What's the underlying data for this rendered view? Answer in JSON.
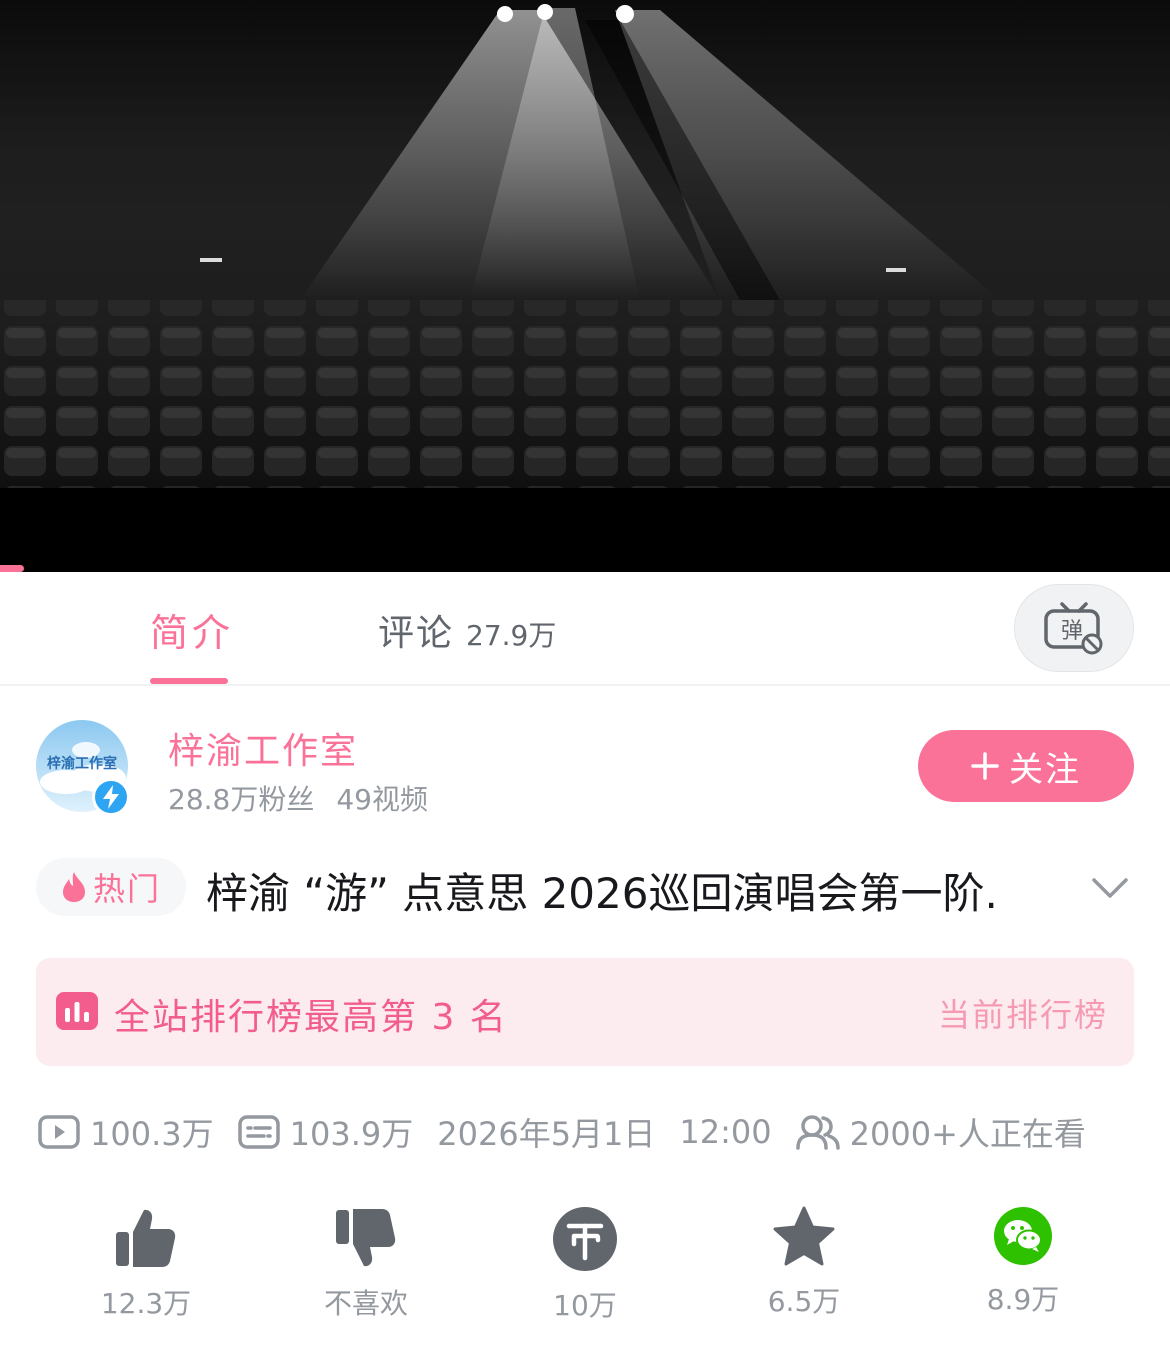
{
  "tabs": {
    "intro_label": "简介",
    "comment_label": "评论",
    "comment_count": "27.9万",
    "danmaku_icon": "danmaku-off-icon"
  },
  "uploader": {
    "name": "梓渝工作室",
    "avatar_text": "梓渝工作室",
    "fans": "28.8万粉丝",
    "videos": "49视频",
    "follow_label": "关注"
  },
  "video": {
    "hot_label": "热门",
    "title": "梓渝 “游” 点意思 2026巡回演唱会第一阶."
  },
  "ranking": {
    "text": "全站排行榜最高第 3 名",
    "link": "当前排行榜"
  },
  "stats": {
    "plays": "100.3万",
    "danmaku": "103.9万",
    "date": "2026年5月1日",
    "time": "12:00",
    "watching": "2000+人正在看"
  },
  "actions": {
    "like": "12.3万",
    "dislike": "不喜欢",
    "coin": "10万",
    "favorite": "6.5万",
    "share": "8.9万"
  },
  "colors": {
    "accent": "#fb7299",
    "rank_bg": "#fdecef",
    "secondary_text": "#9499a0",
    "wechat": "#2dc100"
  }
}
